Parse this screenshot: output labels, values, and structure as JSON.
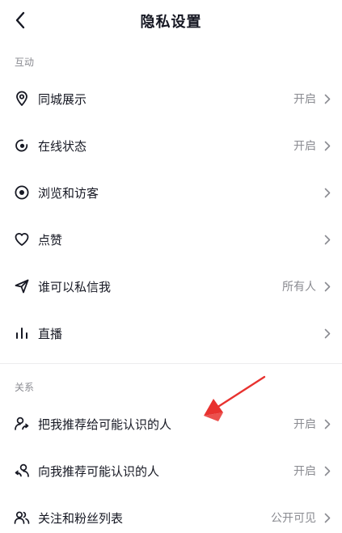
{
  "header": {
    "title": "隐私设置"
  },
  "sections": {
    "interaction": {
      "label": "互动",
      "items": [
        {
          "label": "同城展示",
          "value": "开启",
          "icon": "location-pin-icon"
        },
        {
          "label": "在线状态",
          "value": "开启",
          "icon": "online-status-icon"
        },
        {
          "label": "浏览和访客",
          "value": "",
          "icon": "eye-icon"
        },
        {
          "label": "点赞",
          "value": "",
          "icon": "heart-icon"
        },
        {
          "label": "谁可以私信我",
          "value": "所有人",
          "icon": "paper-plane-icon"
        },
        {
          "label": "直播",
          "value": "",
          "icon": "live-bars-icon"
        }
      ]
    },
    "relations": {
      "label": "关系",
      "items": [
        {
          "label": "把我推荐给可能认识的人",
          "value": "开启",
          "icon": "user-share-icon"
        },
        {
          "label": "向我推荐可能认识的人",
          "value": "开启",
          "icon": "user-recommend-icon"
        },
        {
          "label": "关注和粉丝列表",
          "value": "公开可见",
          "icon": "users-icon"
        }
      ]
    }
  },
  "colors": {
    "text_primary": "#161823",
    "text_secondary": "#8a8b91",
    "annotation_arrow": "#e8322f"
  }
}
